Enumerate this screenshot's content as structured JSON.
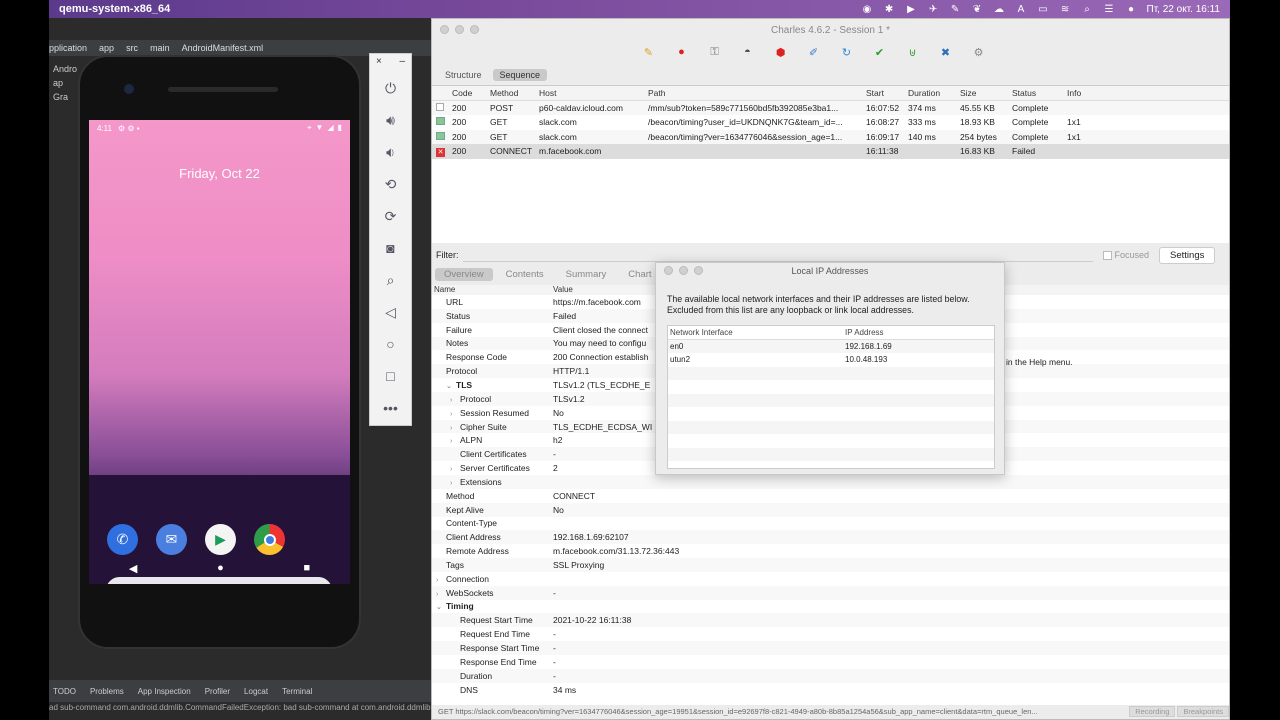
{
  "menubar": {
    "app_title": "qemu-system-x86_64",
    "clock": "Пт, 22 окт. 16:11"
  },
  "studio": {
    "crumbs": [
      "pplication",
      "app",
      "src",
      "main",
      "AndroidManifest.xml"
    ],
    "project_items": [
      "Andro",
      "ap",
      "Gra"
    ],
    "bottom_tabs": [
      "TODO",
      "Problems",
      "App Inspection",
      "Profiler",
      "Logcat",
      "Terminal"
    ],
    "status_line": "ad sub-command com.android.ddmlib.CommandFailedException: bad sub-command at com.android.ddmlib..."
  },
  "phone": {
    "time": "4:11",
    "date": "Friday, Oct 22"
  },
  "charles": {
    "title": "Charles 4.6.2 - Session 1 *",
    "view_tabs": [
      "Structure",
      "Sequence"
    ],
    "columns": [
      "Code",
      "Method",
      "Host",
      "Path",
      "Start",
      "Duration",
      "Size",
      "Status",
      "Info"
    ],
    "rows": [
      {
        "code": "200",
        "method": "POST",
        "host": "p60-caldav.icloud.com",
        "path": "/mm/sub?token=589c771560bd5fb392085e3ba1...",
        "start": "16:07:52",
        "duration": "374 ms",
        "size": "45.55 KB",
        "status": "Complete",
        "info": ""
      },
      {
        "code": "200",
        "method": "GET",
        "host": "slack.com",
        "path": "/beacon/timing?user_id=UKDNQNK7G&team_id=...",
        "start": "16:08:27",
        "duration": "333 ms",
        "size": "18.93 KB",
        "status": "Complete",
        "info": "1x1"
      },
      {
        "code": "200",
        "method": "GET",
        "host": "slack.com",
        "path": "/beacon/timing?ver=1634776046&session_age=1...",
        "start": "16:09:17",
        "duration": "140 ms",
        "size": "254 bytes",
        "status": "Complete",
        "info": "1x1"
      },
      {
        "code": "200",
        "method": "CONNECT",
        "host": "m.facebook.com",
        "path": "",
        "start": "16:11:38",
        "duration": "",
        "size": "16.83 KB",
        "status": "Failed",
        "info": ""
      }
    ],
    "filter_label": "Filter:",
    "focused_label": "Focused",
    "settings_label": "Settings",
    "detail_tabs": [
      "Overview",
      "Contents",
      "Summary",
      "Chart"
    ],
    "detail_cols": [
      "Name",
      "Value"
    ],
    "details": [
      {
        "k": "URL",
        "v": "https://m.facebook.com",
        "lvl": 0
      },
      {
        "k": "Status",
        "v": "Failed",
        "lvl": 0
      },
      {
        "k": "Failure",
        "v": "Client closed the connect",
        "lvl": 0
      },
      {
        "k": "Notes",
        "v": "You may need to configu",
        "lvl": 0
      },
      {
        "k": "Response Code",
        "v": "200 Connection establish",
        "lvl": 0
      },
      {
        "k": "Protocol",
        "v": "HTTP/1.1",
        "lvl": 0
      },
      {
        "k": "TLS",
        "v": "TLSv1.2 (TLS_ECDHE_E",
        "lvl": 0,
        "bold": true,
        "open": true
      },
      {
        "k": "Protocol",
        "v": "TLSv1.2",
        "lvl": 1,
        "tw": true
      },
      {
        "k": "Session Resumed",
        "v": "No",
        "lvl": 1,
        "tw": true
      },
      {
        "k": "Cipher Suite",
        "v": "TLS_ECDHE_ECDSA_WI",
        "lvl": 1,
        "tw": true
      },
      {
        "k": "ALPN",
        "v": "h2",
        "lvl": 1,
        "tw": true
      },
      {
        "k": "Client Certificates",
        "v": "-",
        "lvl": 1
      },
      {
        "k": "Server Certificates",
        "v": "2",
        "lvl": 1,
        "tw": true
      },
      {
        "k": "Extensions",
        "v": "",
        "lvl": 1,
        "tw": true
      },
      {
        "k": "Method",
        "v": "CONNECT",
        "lvl": 0
      },
      {
        "k": "Kept Alive",
        "v": "No",
        "lvl": 0
      },
      {
        "k": "Content-Type",
        "v": "",
        "lvl": 0
      },
      {
        "k": "Client Address",
        "v": "192.168.1.69:62107",
        "lvl": 0
      },
      {
        "k": "Remote Address",
        "v": "m.facebook.com/31.13.72.36:443",
        "lvl": 0
      },
      {
        "k": "Tags",
        "v": "SSL Proxying",
        "lvl": 0
      },
      {
        "k": "Connection",
        "v": "",
        "lvl": -1,
        "tw": true
      },
      {
        "k": "WebSockets",
        "v": "-",
        "lvl": -1,
        "tw": true
      },
      {
        "k": "Timing",
        "v": "",
        "lvl": -1,
        "bold": true,
        "open": true
      },
      {
        "k": "Request Start Time",
        "v": "2021-10-22 16:11:38",
        "lvl": 1
      },
      {
        "k": "Request End Time",
        "v": "-",
        "lvl": 1
      },
      {
        "k": "Response Start Time",
        "v": "-",
        "lvl": 1
      },
      {
        "k": "Response End Time",
        "v": "-",
        "lvl": 1
      },
      {
        "k": "Duration",
        "v": "-",
        "lvl": 1
      },
      {
        "k": "DNS",
        "v": "34 ms",
        "lvl": 1
      }
    ],
    "notes_tail": "in the Help menu.",
    "status_url": "GET https://slack.com/beacon/timing?ver=1634776046&session_age=19951&session_id=e92697f8-c821-4949-a80b-8b85a1254a56&sub_app_name=client&data=rtm_queue_len...",
    "status_buttons": [
      "Recording",
      "Breakpoints"
    ]
  },
  "ip_dialog": {
    "title": "Local IP Addresses",
    "description": "The available local network interfaces and their IP addresses are listed below.  Excluded from this list are any loopback or link local addresses.",
    "columns": [
      "Network Interface",
      "IP Address"
    ],
    "rows": [
      {
        "iface": "en0",
        "ip": "192.168.1.69"
      },
      {
        "iface": "utun2",
        "ip": "10.0.48.193"
      }
    ]
  }
}
